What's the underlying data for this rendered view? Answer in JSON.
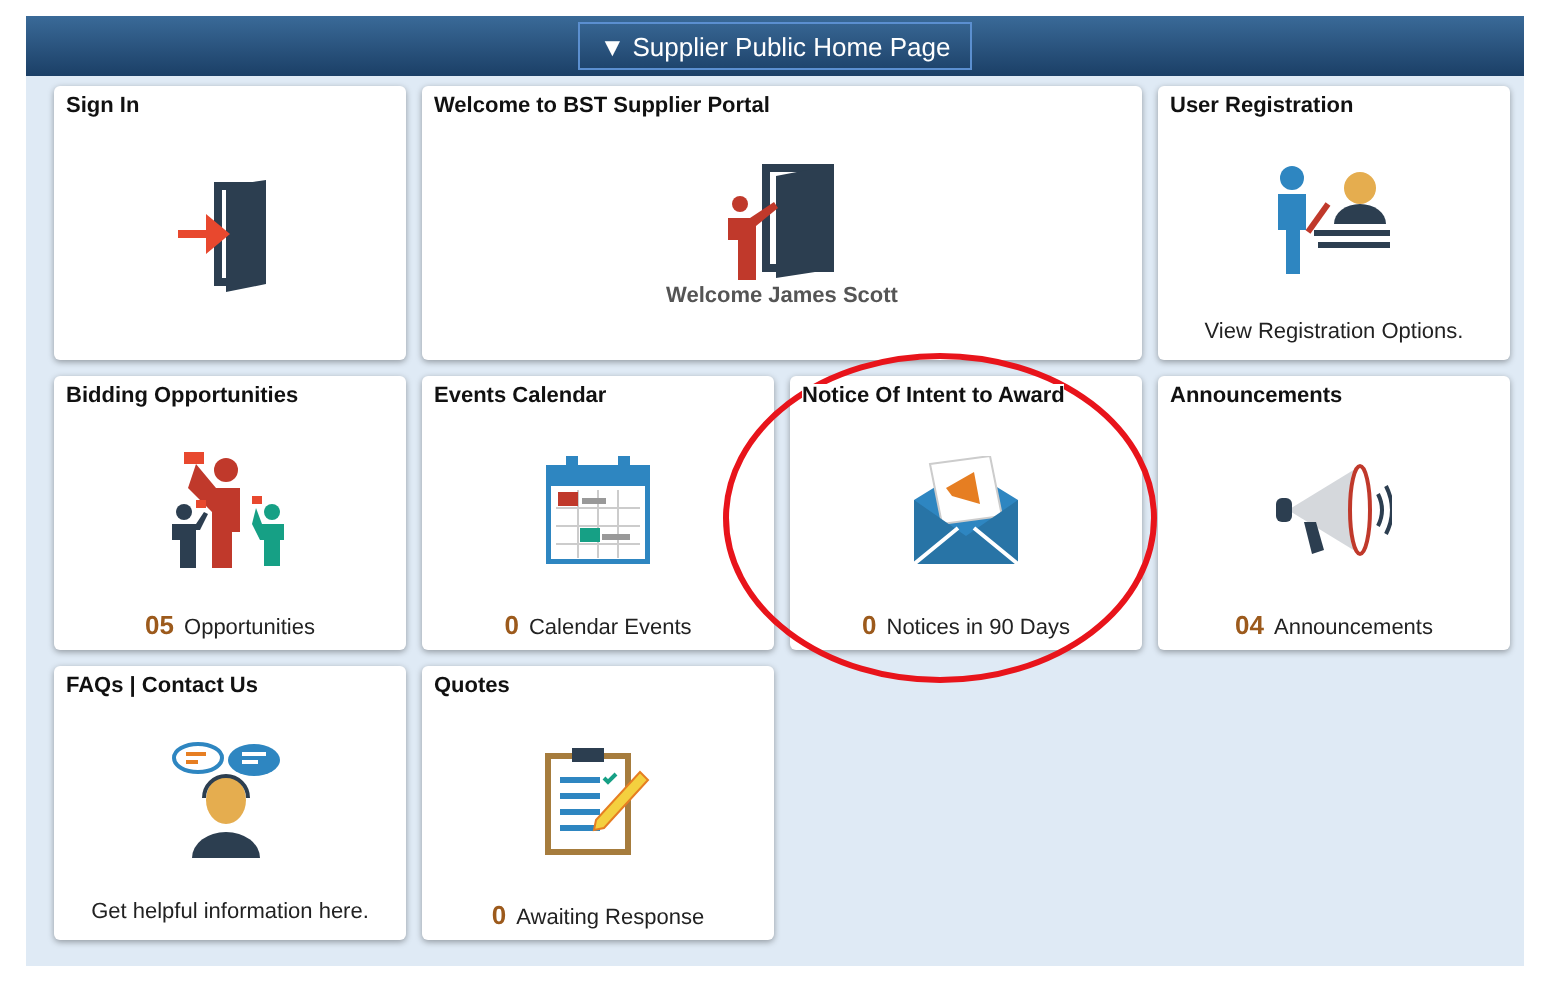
{
  "header": {
    "title": "Supplier Public Home Page",
    "caret": "▼"
  },
  "tiles": [
    {
      "kind": "sign-in",
      "title": "Sign In"
    },
    {
      "kind": "welcome",
      "title": "Welcome to BST Supplier Portal",
      "caption": "Welcome James Scott"
    },
    {
      "kind": "registration",
      "title": "User Registration",
      "footer_text": "View Registration Options."
    },
    {
      "kind": "bidding",
      "title": "Bidding Opportunities",
      "count": "05",
      "footer_text": "Opportunities"
    },
    {
      "kind": "calendar",
      "title": "Events Calendar",
      "count": "0",
      "footer_text": "Calendar Events"
    },
    {
      "kind": "notice",
      "title": "Notice Of Intent to Award",
      "count": "0",
      "footer_text": "Notices in 90 Days"
    },
    {
      "kind": "announcements",
      "title": "Announcements",
      "count": "04",
      "footer_text": "Announcements"
    },
    {
      "kind": "faq",
      "title": "FAQs | Contact Us",
      "footer_text": "Get helpful information here."
    },
    {
      "kind": "quotes",
      "title": "Quotes",
      "count": "0",
      "footer_text": "Awaiting Response"
    }
  ]
}
